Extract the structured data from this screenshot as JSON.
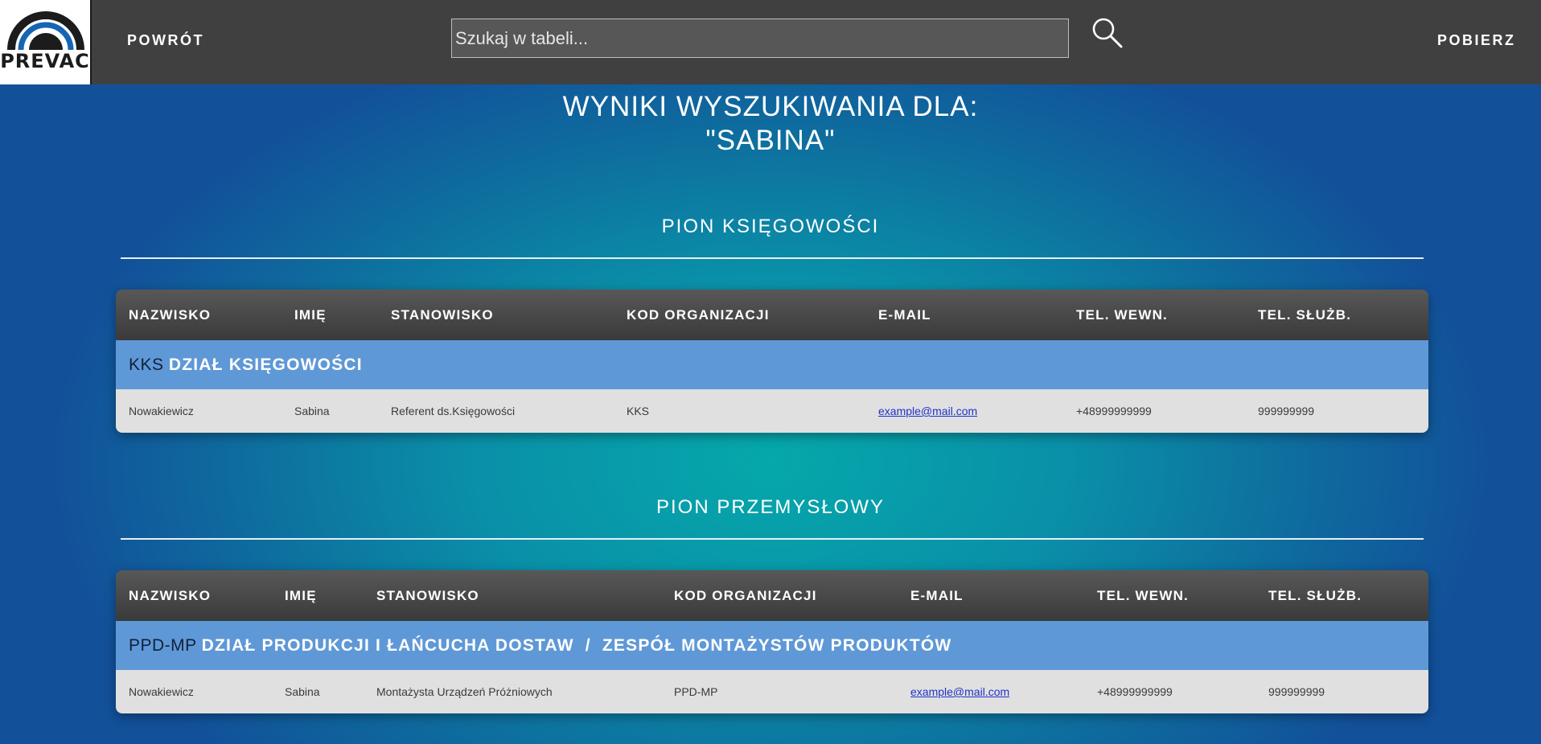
{
  "header": {
    "logo_text": "PREVAC",
    "back_label": "POWRÓT",
    "search": {
      "placeholder": "Szukaj w tabeli..."
    },
    "search_icon": "search-icon",
    "download_label": "POBIERZ"
  },
  "results": {
    "title_line1": "WYNIKI WYSZUKIWANIA DLA:",
    "title_line2": "\"SABINA\""
  },
  "columns": [
    "NAZWISKO",
    "IMIĘ",
    "STANOWISKO",
    "KOD ORGANIZACJI",
    "E-MAIL",
    "TEL. WEWN.",
    "TEL. SŁUŻB."
  ],
  "sections": [
    {
      "title": "PION KSIĘGOWOŚCI",
      "group_code": "KKS",
      "group_name": "DZIAŁ KSIĘGOWOŚCI",
      "rows": [
        [
          "Nowakiewicz",
          "Sabina",
          "Referent ds.Księgowości",
          "KKS",
          "example@mail.com",
          "+48999999999",
          "999999999"
        ]
      ]
    },
    {
      "title": "PION PRZEMYSŁOWY",
      "group_code": "PPD-MP",
      "group_name": "DZIAŁ PRODUKCJI I ŁAŃCUCHA DOSTAW  /  ZESPÓŁ MONTAŻYSTÓW PRODUKTÓW",
      "rows": [
        [
          "Nowakiewicz",
          "Sabina",
          "Montażysta Urządzeń Próżniowych",
          "PPD-MP",
          "example@mail.com",
          "+48999999999",
          "999999999"
        ]
      ]
    }
  ],
  "colors": {
    "topbar": "#404040",
    "group_row": "#5f98d6",
    "data_row": "#e0e0e0",
    "link": "#2033c8"
  }
}
